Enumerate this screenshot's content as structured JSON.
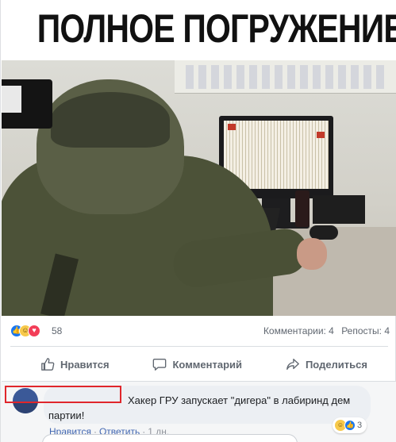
{
  "meme": {
    "caption": "ПОЛНОЕ ПОГРУЖЕНИЕ"
  },
  "post": {
    "reaction_icons": [
      "like",
      "haha",
      "love"
    ],
    "reaction_count": "58",
    "comments_count": "Комментарии: 4",
    "shares_count": "Репосты: 4"
  },
  "actions": {
    "like_label": "Нравится",
    "comment_label": "Комментарий",
    "share_label": "Поделиться"
  },
  "comment": {
    "text_line1": "Хакер ГРУ запускает \"дигера\" в лабиринд дем",
    "text_line2": "партии!",
    "reactions": [
      "haha",
      "like"
    ],
    "reaction_count": "3",
    "like_link": "Нравится",
    "reply_link": "Ответить",
    "time": "1 дн."
  },
  "colors": {
    "accent": "#4267b2",
    "like_blue": "#1877f2",
    "redaction": "#e0262b"
  }
}
